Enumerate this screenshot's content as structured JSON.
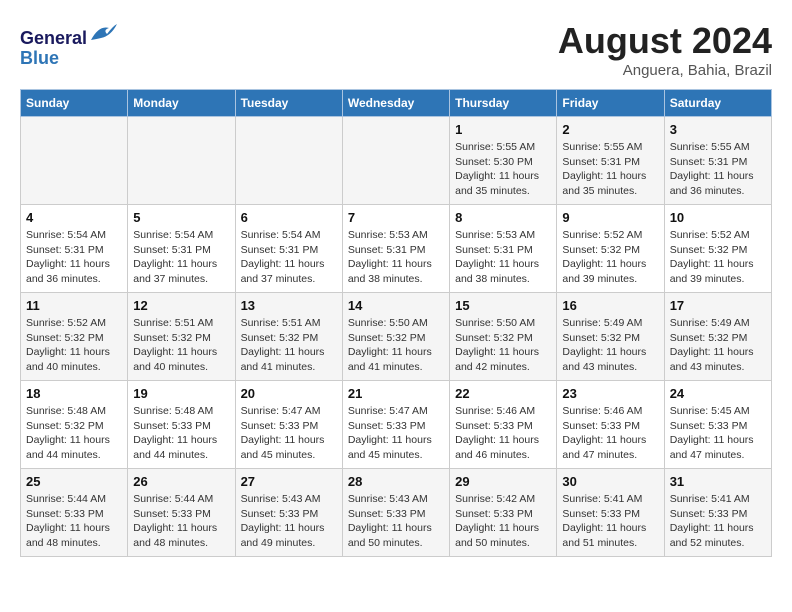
{
  "header": {
    "logo_line1": "General",
    "logo_line2": "Blue",
    "month": "August 2024",
    "location": "Anguera, Bahia, Brazil"
  },
  "weekdays": [
    "Sunday",
    "Monday",
    "Tuesday",
    "Wednesday",
    "Thursday",
    "Friday",
    "Saturday"
  ],
  "weeks": [
    [
      {
        "day": "",
        "info": ""
      },
      {
        "day": "",
        "info": ""
      },
      {
        "day": "",
        "info": ""
      },
      {
        "day": "",
        "info": ""
      },
      {
        "day": "1",
        "info": "Sunrise: 5:55 AM\nSunset: 5:30 PM\nDaylight: 11 hours\nand 35 minutes."
      },
      {
        "day": "2",
        "info": "Sunrise: 5:55 AM\nSunset: 5:31 PM\nDaylight: 11 hours\nand 35 minutes."
      },
      {
        "day": "3",
        "info": "Sunrise: 5:55 AM\nSunset: 5:31 PM\nDaylight: 11 hours\nand 36 minutes."
      }
    ],
    [
      {
        "day": "4",
        "info": "Sunrise: 5:54 AM\nSunset: 5:31 PM\nDaylight: 11 hours\nand 36 minutes."
      },
      {
        "day": "5",
        "info": "Sunrise: 5:54 AM\nSunset: 5:31 PM\nDaylight: 11 hours\nand 37 minutes."
      },
      {
        "day": "6",
        "info": "Sunrise: 5:54 AM\nSunset: 5:31 PM\nDaylight: 11 hours\nand 37 minutes."
      },
      {
        "day": "7",
        "info": "Sunrise: 5:53 AM\nSunset: 5:31 PM\nDaylight: 11 hours\nand 38 minutes."
      },
      {
        "day": "8",
        "info": "Sunrise: 5:53 AM\nSunset: 5:31 PM\nDaylight: 11 hours\nand 38 minutes."
      },
      {
        "day": "9",
        "info": "Sunrise: 5:52 AM\nSunset: 5:32 PM\nDaylight: 11 hours\nand 39 minutes."
      },
      {
        "day": "10",
        "info": "Sunrise: 5:52 AM\nSunset: 5:32 PM\nDaylight: 11 hours\nand 39 minutes."
      }
    ],
    [
      {
        "day": "11",
        "info": "Sunrise: 5:52 AM\nSunset: 5:32 PM\nDaylight: 11 hours\nand 40 minutes."
      },
      {
        "day": "12",
        "info": "Sunrise: 5:51 AM\nSunset: 5:32 PM\nDaylight: 11 hours\nand 40 minutes."
      },
      {
        "day": "13",
        "info": "Sunrise: 5:51 AM\nSunset: 5:32 PM\nDaylight: 11 hours\nand 41 minutes."
      },
      {
        "day": "14",
        "info": "Sunrise: 5:50 AM\nSunset: 5:32 PM\nDaylight: 11 hours\nand 41 minutes."
      },
      {
        "day": "15",
        "info": "Sunrise: 5:50 AM\nSunset: 5:32 PM\nDaylight: 11 hours\nand 42 minutes."
      },
      {
        "day": "16",
        "info": "Sunrise: 5:49 AM\nSunset: 5:32 PM\nDaylight: 11 hours\nand 43 minutes."
      },
      {
        "day": "17",
        "info": "Sunrise: 5:49 AM\nSunset: 5:32 PM\nDaylight: 11 hours\nand 43 minutes."
      }
    ],
    [
      {
        "day": "18",
        "info": "Sunrise: 5:48 AM\nSunset: 5:32 PM\nDaylight: 11 hours\nand 44 minutes."
      },
      {
        "day": "19",
        "info": "Sunrise: 5:48 AM\nSunset: 5:33 PM\nDaylight: 11 hours\nand 44 minutes."
      },
      {
        "day": "20",
        "info": "Sunrise: 5:47 AM\nSunset: 5:33 PM\nDaylight: 11 hours\nand 45 minutes."
      },
      {
        "day": "21",
        "info": "Sunrise: 5:47 AM\nSunset: 5:33 PM\nDaylight: 11 hours\nand 45 minutes."
      },
      {
        "day": "22",
        "info": "Sunrise: 5:46 AM\nSunset: 5:33 PM\nDaylight: 11 hours\nand 46 minutes."
      },
      {
        "day": "23",
        "info": "Sunrise: 5:46 AM\nSunset: 5:33 PM\nDaylight: 11 hours\nand 47 minutes."
      },
      {
        "day": "24",
        "info": "Sunrise: 5:45 AM\nSunset: 5:33 PM\nDaylight: 11 hours\nand 47 minutes."
      }
    ],
    [
      {
        "day": "25",
        "info": "Sunrise: 5:44 AM\nSunset: 5:33 PM\nDaylight: 11 hours\nand 48 minutes."
      },
      {
        "day": "26",
        "info": "Sunrise: 5:44 AM\nSunset: 5:33 PM\nDaylight: 11 hours\nand 48 minutes."
      },
      {
        "day": "27",
        "info": "Sunrise: 5:43 AM\nSunset: 5:33 PM\nDaylight: 11 hours\nand 49 minutes."
      },
      {
        "day": "28",
        "info": "Sunrise: 5:43 AM\nSunset: 5:33 PM\nDaylight: 11 hours\nand 50 minutes."
      },
      {
        "day": "29",
        "info": "Sunrise: 5:42 AM\nSunset: 5:33 PM\nDaylight: 11 hours\nand 50 minutes."
      },
      {
        "day": "30",
        "info": "Sunrise: 5:41 AM\nSunset: 5:33 PM\nDaylight: 11 hours\nand 51 minutes."
      },
      {
        "day": "31",
        "info": "Sunrise: 5:41 AM\nSunset: 5:33 PM\nDaylight: 11 hours\nand 52 minutes."
      }
    ]
  ]
}
